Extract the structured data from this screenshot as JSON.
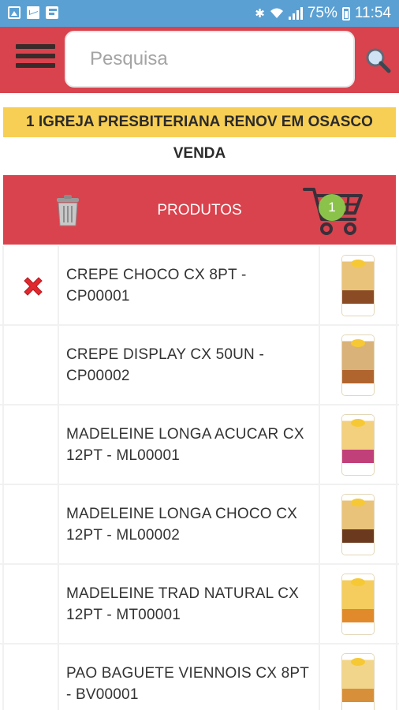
{
  "status_bar": {
    "battery": "75%",
    "time": "11:54"
  },
  "header": {
    "search_placeholder": "Pesquisa"
  },
  "church": {
    "name": "1 IGREJA PRESBITERIANA RENOV EM OSASCO"
  },
  "mode": {
    "label": "VENDA"
  },
  "products_bar": {
    "title": "PRODUTOS",
    "cart_count": "1"
  },
  "products": [
    {
      "name": "CREPE CHOCO CX 8PT - CP00001",
      "in_cart": true,
      "pkg_color": "#e9c37a",
      "pkg_accent": "#8a4b25"
    },
    {
      "name": "CREPE DISPLAY CX 50UN - CP00002",
      "in_cart": false,
      "pkg_color": "#d9b27a",
      "pkg_accent": "#b0652f"
    },
    {
      "name": "MADELEINE LONGA ACUCAR CX 12PT - ML00001",
      "in_cart": false,
      "pkg_color": "#f2d07e",
      "pkg_accent": "#c2407a"
    },
    {
      "name": "MADELEINE LONGA CHOCO CX 12PT - ML00002",
      "in_cart": false,
      "pkg_color": "#e9c37a",
      "pkg_accent": "#6b3a1e"
    },
    {
      "name": "MADELEINE TRAD NATURAL CX 12PT - MT00001",
      "in_cart": false,
      "pkg_color": "#f4cd5e",
      "pkg_accent": "#e08a2c"
    },
    {
      "name": "PAO BAGUETE VIENNOIS CX 8PT - BV00001",
      "in_cart": false,
      "pkg_color": "#f1d58a",
      "pkg_accent": "#d88f3a"
    }
  ]
}
